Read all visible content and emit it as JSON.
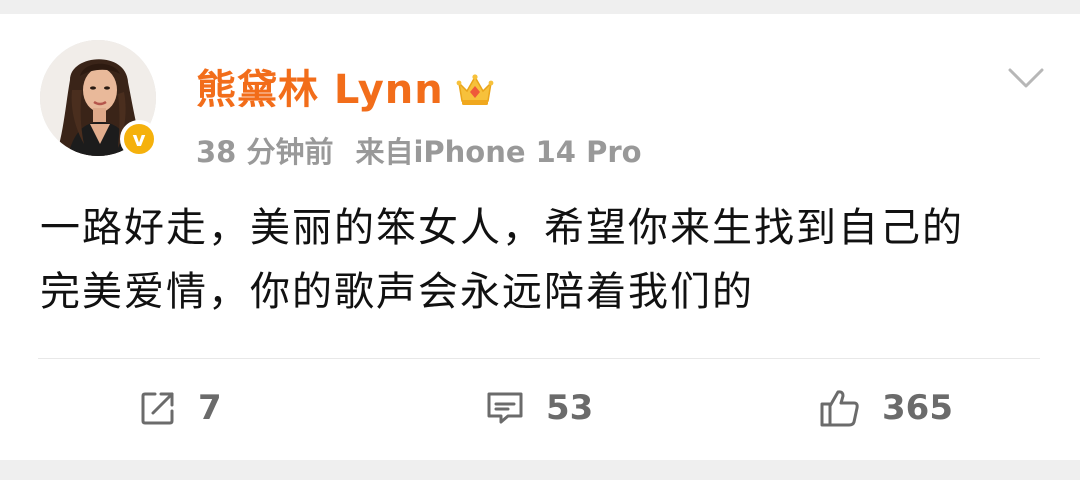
{
  "post": {
    "username": "熊黛林 Lynn",
    "time": "38 分钟前",
    "source": "来自iPhone 14 Pro",
    "text_line1": "一路好走，美丽的笨女人，希望你来生找到自己的",
    "text_line2": "完美爱情，你的歌声会永远陪着我们的",
    "verified_symbol": "v"
  },
  "actions": {
    "repost_count": "7",
    "comment_count": "53",
    "like_count": "365"
  },
  "colors": {
    "username": "#f26d1a",
    "meta": "#999999",
    "verified_badge": "#f5b10c",
    "action_icon": "#6b6b6b"
  },
  "icons": {
    "crown": "crown-icon",
    "menu": "chevron-down-icon",
    "repost": "repost-icon",
    "comment": "comment-icon",
    "like": "thumbs-up-icon"
  }
}
